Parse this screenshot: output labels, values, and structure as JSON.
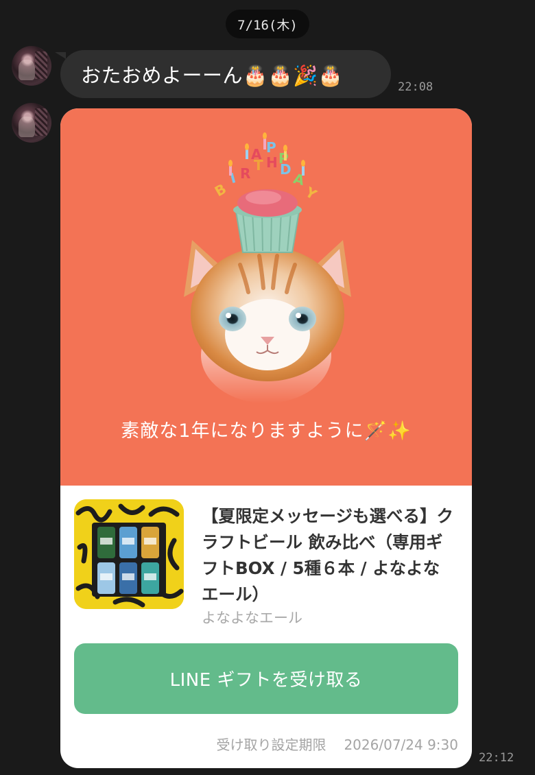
{
  "date_separator": "7/16(木)",
  "messages": [
    {
      "type": "text",
      "text": "おたおめよーーん🎂🎂🎉🎂",
      "time": "22:08"
    },
    {
      "type": "gift_card",
      "time": "22:12",
      "hero_caption": "素敵な1年になりますように🪄✨",
      "hero_image": "birthday-kitten-with-cupcake-hat",
      "hero_background": "#f37355",
      "product": {
        "title": "【夏限定メッセージも選べる】クラフトビール 飲み比べ（専用ギフトBOX / 5種６本 / よなよなエール）",
        "brand": "よなよなエール"
      },
      "button_label": "LINE ギフトを受け取る",
      "button_color": "#63bb8b",
      "expiry_label": "受け取り設定期限",
      "expiry_value": "2026/07/24 9:30"
    }
  ],
  "colors": {
    "background": "#1a1a1a",
    "bubble": "#2f2f2f"
  }
}
